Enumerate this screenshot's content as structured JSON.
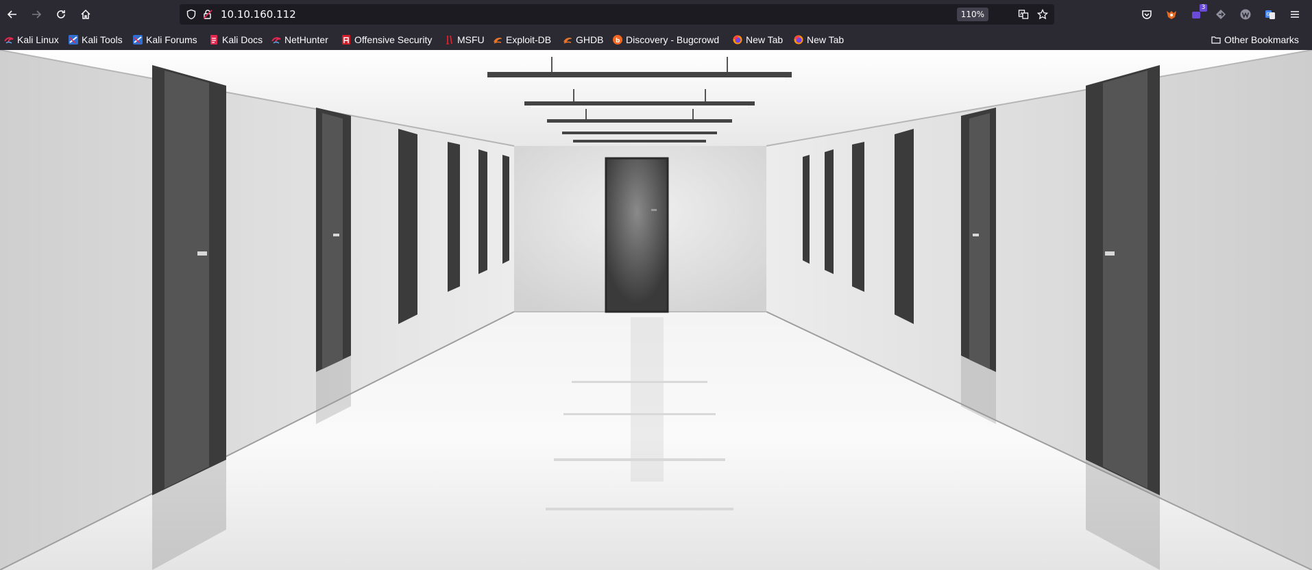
{
  "browser": {
    "url": "10.10.160.112",
    "zoom": "110%",
    "extension_badge_count": "3",
    "theme_colors": {
      "toolbar": "#2b2a33",
      "urlbar": "#1c1b22",
      "text": "#fbfbfe"
    }
  },
  "bookmarks": [
    {
      "label": "Kali Linux",
      "icon": "kali-dragon-icon"
    },
    {
      "label": "Kali Tools",
      "icon": "kali-tools-icon"
    },
    {
      "label": "Kali Forums",
      "icon": "kali-forums-icon"
    },
    {
      "label": "Kali Docs",
      "icon": "kali-docs-icon"
    },
    {
      "label": "NetHunter",
      "icon": "nethunter-icon"
    },
    {
      "label": "Offensive Security",
      "icon": "offsec-icon"
    },
    {
      "label": "MSFU",
      "icon": "msfu-icon"
    },
    {
      "label": "Exploit-DB",
      "icon": "exploitdb-icon"
    },
    {
      "label": "GHDB",
      "icon": "ghdb-icon"
    },
    {
      "label": "Discovery - Bugcrowd",
      "icon": "bugcrowd-icon"
    },
    {
      "label": "New Tab",
      "icon": "firefox-icon"
    },
    {
      "label": "New Tab",
      "icon": "firefox-icon"
    }
  ],
  "other_bookmarks": "Other Bookmarks"
}
